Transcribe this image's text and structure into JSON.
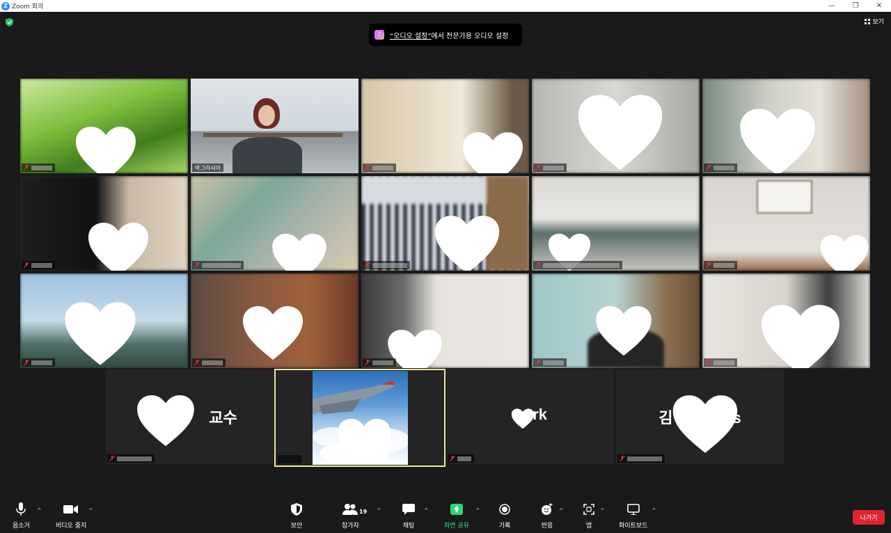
{
  "window": {
    "title": "Zoom 회의",
    "logo_letter": "Z",
    "min_label": "—",
    "restore_label": "❐",
    "close_label": "✕"
  },
  "header": {
    "view_label": "보기",
    "notice_prefix": "“오디오 설정”",
    "notice_rest": "에서 전문가용 오디오 설정"
  },
  "participants": {
    "host_name": "박그라시아",
    "card_names": [
      "교수",
      "rk",
      "김 s"
    ]
  },
  "toolbar": {
    "mute_label": "음소거",
    "video_label": "비디오 중지",
    "security_label": "보안",
    "participants_label": "참가자",
    "participants_count": "19",
    "chat_label": "채팅",
    "share_label": "화면 공유",
    "record_label": "기록",
    "reactions_label": "반응",
    "apps_label": "앱",
    "whiteboard_label": "화이트보드",
    "leave_label": "나가기"
  },
  "colors": {
    "accent_green": "#2fd874",
    "leave_red": "#e0242c",
    "active_border": "#f3e6a0"
  }
}
